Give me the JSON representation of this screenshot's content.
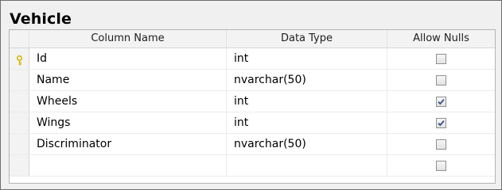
{
  "table": {
    "title": "Vehicle"
  },
  "columns": {
    "column_name": "Column Name",
    "data_type": "Data Type",
    "allow_nulls": "Allow Nulls"
  },
  "rows": [
    {
      "name": "Id",
      "type": "int",
      "allow_nulls": false,
      "primary_key": true
    },
    {
      "name": "Name",
      "type": "nvarchar(50)",
      "allow_nulls": false,
      "primary_key": false
    },
    {
      "name": "Wheels",
      "type": "int",
      "allow_nulls": true,
      "primary_key": false
    },
    {
      "name": "Wings",
      "type": "int",
      "allow_nulls": true,
      "primary_key": false
    },
    {
      "name": "Discriminator",
      "type": "nvarchar(50)",
      "allow_nulls": false,
      "primary_key": false
    },
    {
      "name": "",
      "type": "",
      "allow_nulls": false,
      "primary_key": false
    }
  ],
  "icons": {
    "primary_key": "key-icon",
    "checkbox_checked_mark": "checkmark-icon"
  },
  "colors": {
    "key_icon": "#d8b400",
    "check_mark": "#3a4f86"
  }
}
